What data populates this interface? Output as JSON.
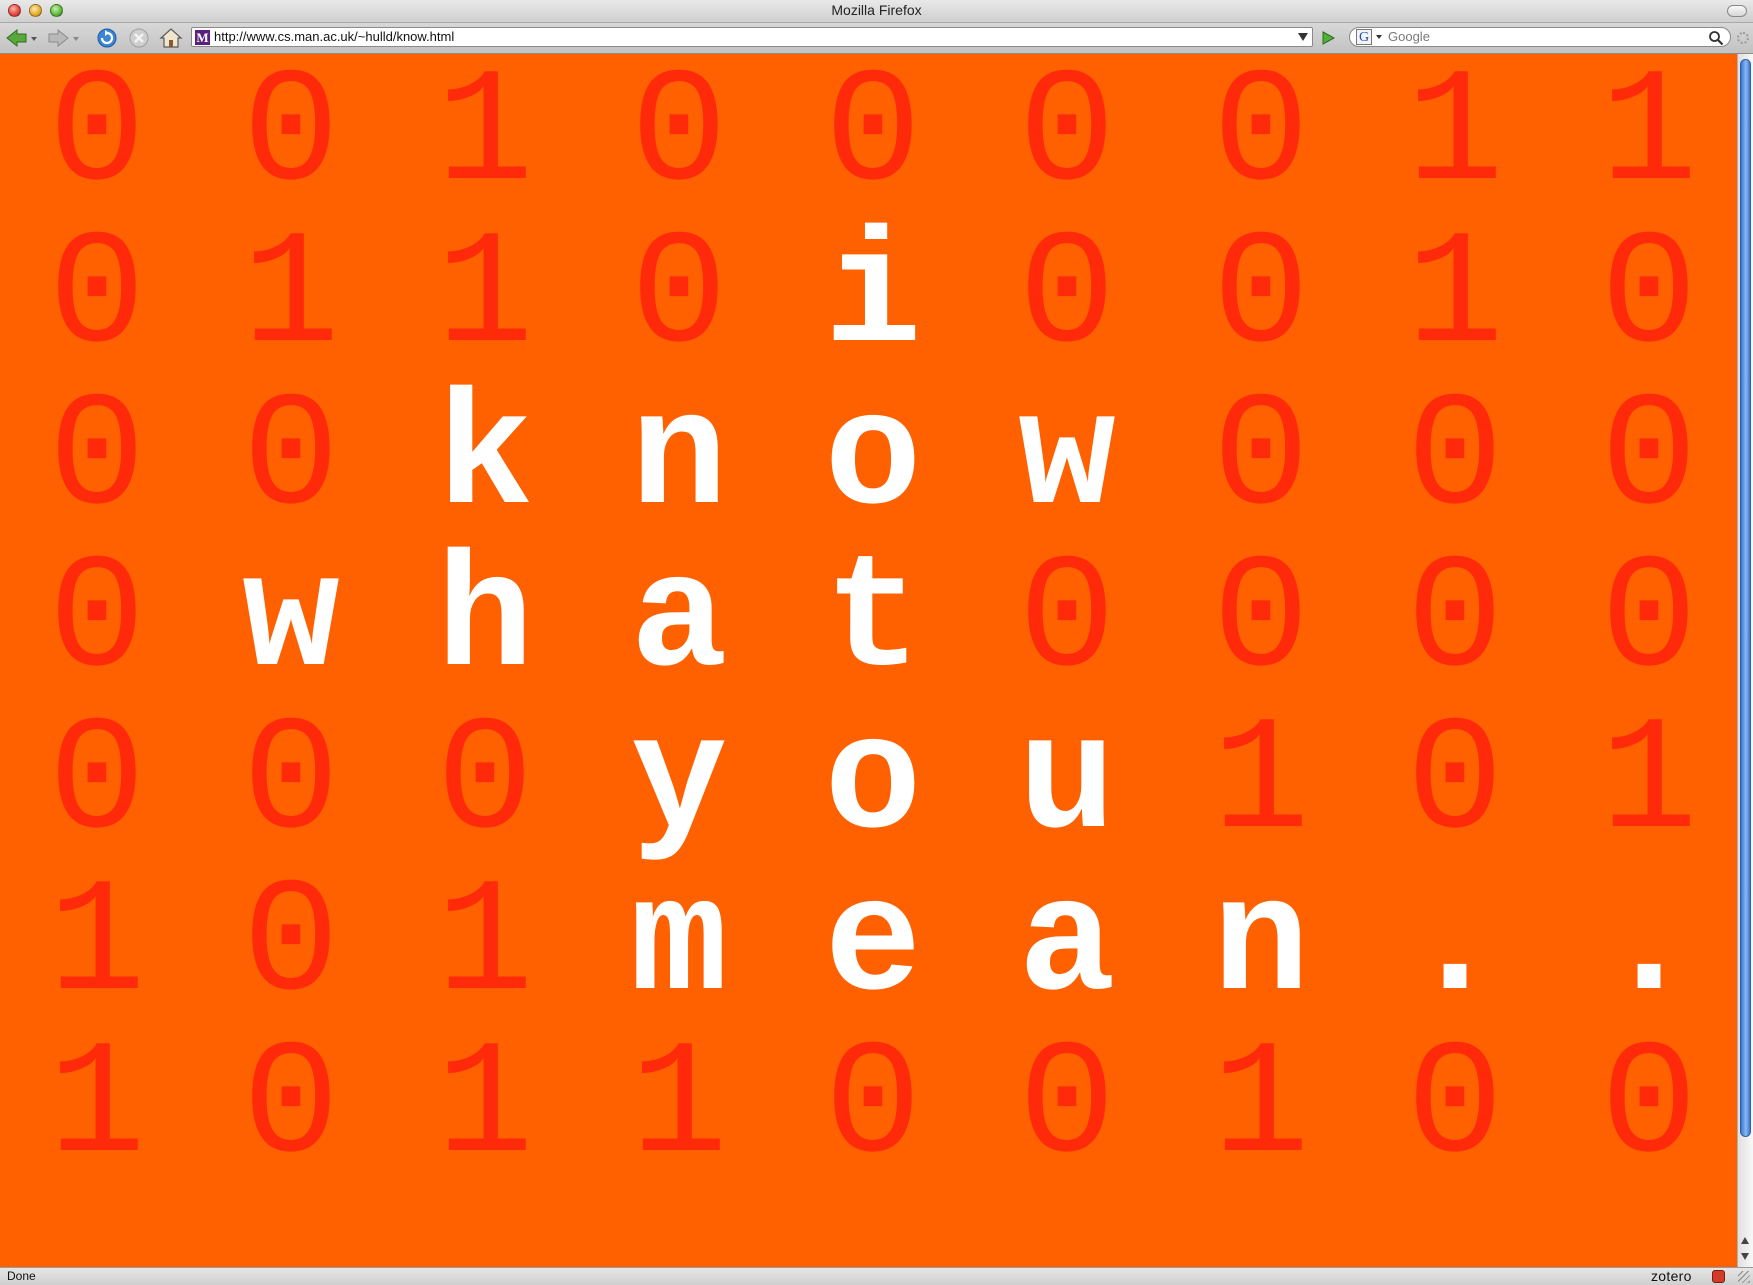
{
  "window": {
    "title": "Mozilla Firefox"
  },
  "toolbar": {
    "back": "back-arrow",
    "forward": "forward-arrow",
    "reload": "reload",
    "stop": "stop",
    "home": "home"
  },
  "urlbar": {
    "favicon_letter": "M",
    "url": "http://www.cs.man.ac.uk/~hulld/know.html"
  },
  "search": {
    "engine_letter": "G",
    "placeholder": "Google"
  },
  "page": {
    "background": "#ff6100",
    "digit_color": "#ff2a0a",
    "letter_color": "#ffffff",
    "grid": [
      [
        "0",
        "0",
        "1",
        "0",
        "0",
        "0",
        "0",
        "1",
        "1"
      ],
      [
        "0",
        "1",
        "1",
        "0",
        "i",
        "0",
        "0",
        "1",
        "0"
      ],
      [
        "0",
        "0",
        "k",
        "n",
        "o",
        "w",
        "0",
        "0",
        "0"
      ],
      [
        "0",
        "w",
        "h",
        "a",
        "t",
        "0",
        "0",
        "0",
        "0"
      ],
      [
        "0",
        "0",
        "0",
        "y",
        "o",
        "u",
        "1",
        "0",
        "1"
      ],
      [
        "1",
        "0",
        "1",
        "m",
        "e",
        "a",
        "n",
        ".",
        "."
      ],
      [
        "1",
        "0",
        "1",
        "1",
        "0",
        "0",
        "1",
        "0",
        "0"
      ]
    ]
  },
  "status": {
    "text": "Done",
    "addon": "zotero"
  }
}
